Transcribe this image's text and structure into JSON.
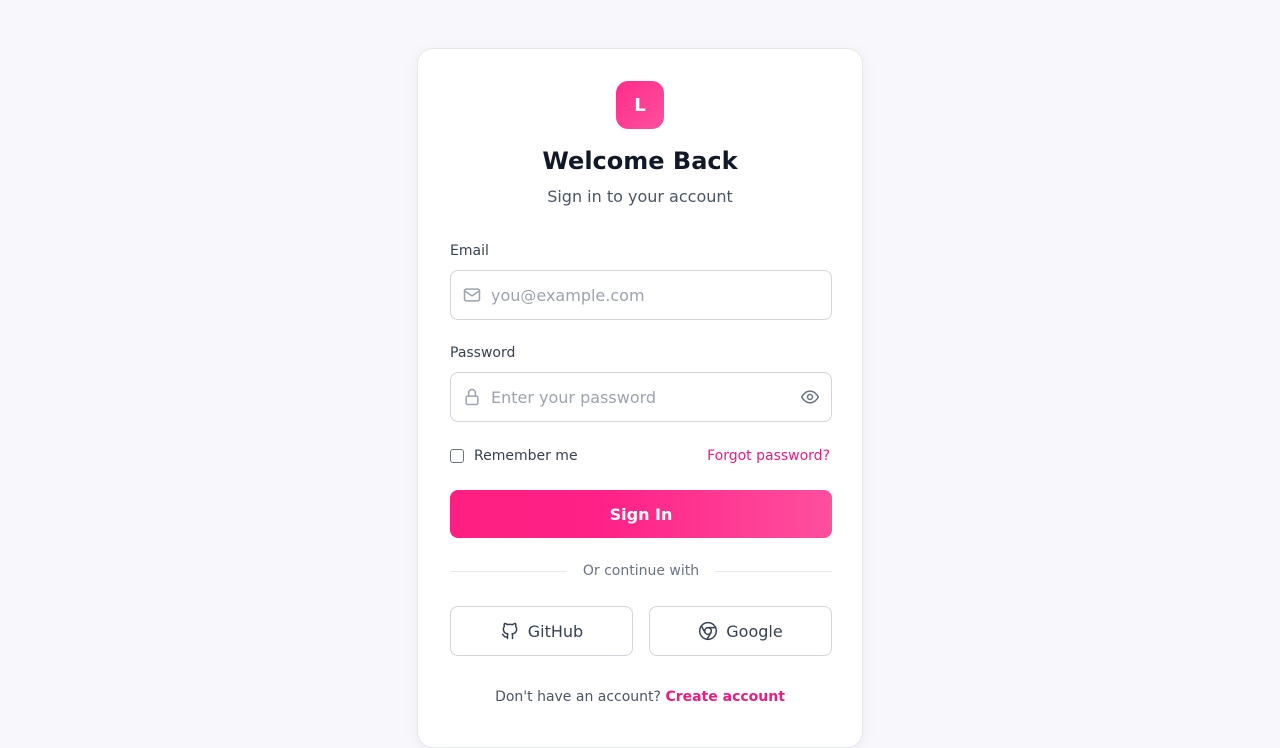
{
  "brand": {
    "logo_letter": "L",
    "accent_color": "#ff1f82"
  },
  "header": {
    "title": "Welcome Back",
    "subtitle": "Sign in to your account"
  },
  "form": {
    "email": {
      "label": "Email",
      "value": "",
      "placeholder": "you@example.com",
      "icon": "mail-icon"
    },
    "password": {
      "label": "Password",
      "value": "",
      "placeholder": "Enter your password",
      "icon": "lock-icon",
      "toggle_icon": "eye-icon"
    },
    "remember_me": {
      "label": "Remember me",
      "checked": false
    },
    "forgot_password_label": "Forgot password?",
    "submit_label": "Sign In"
  },
  "divider_text": "Or continue with",
  "social": [
    {
      "label": "GitHub",
      "icon": "github-icon"
    },
    {
      "label": "Google",
      "icon": "chrome-icon"
    }
  ],
  "footer": {
    "prompt": "Don't have an account?",
    "link_label": "Create account"
  }
}
